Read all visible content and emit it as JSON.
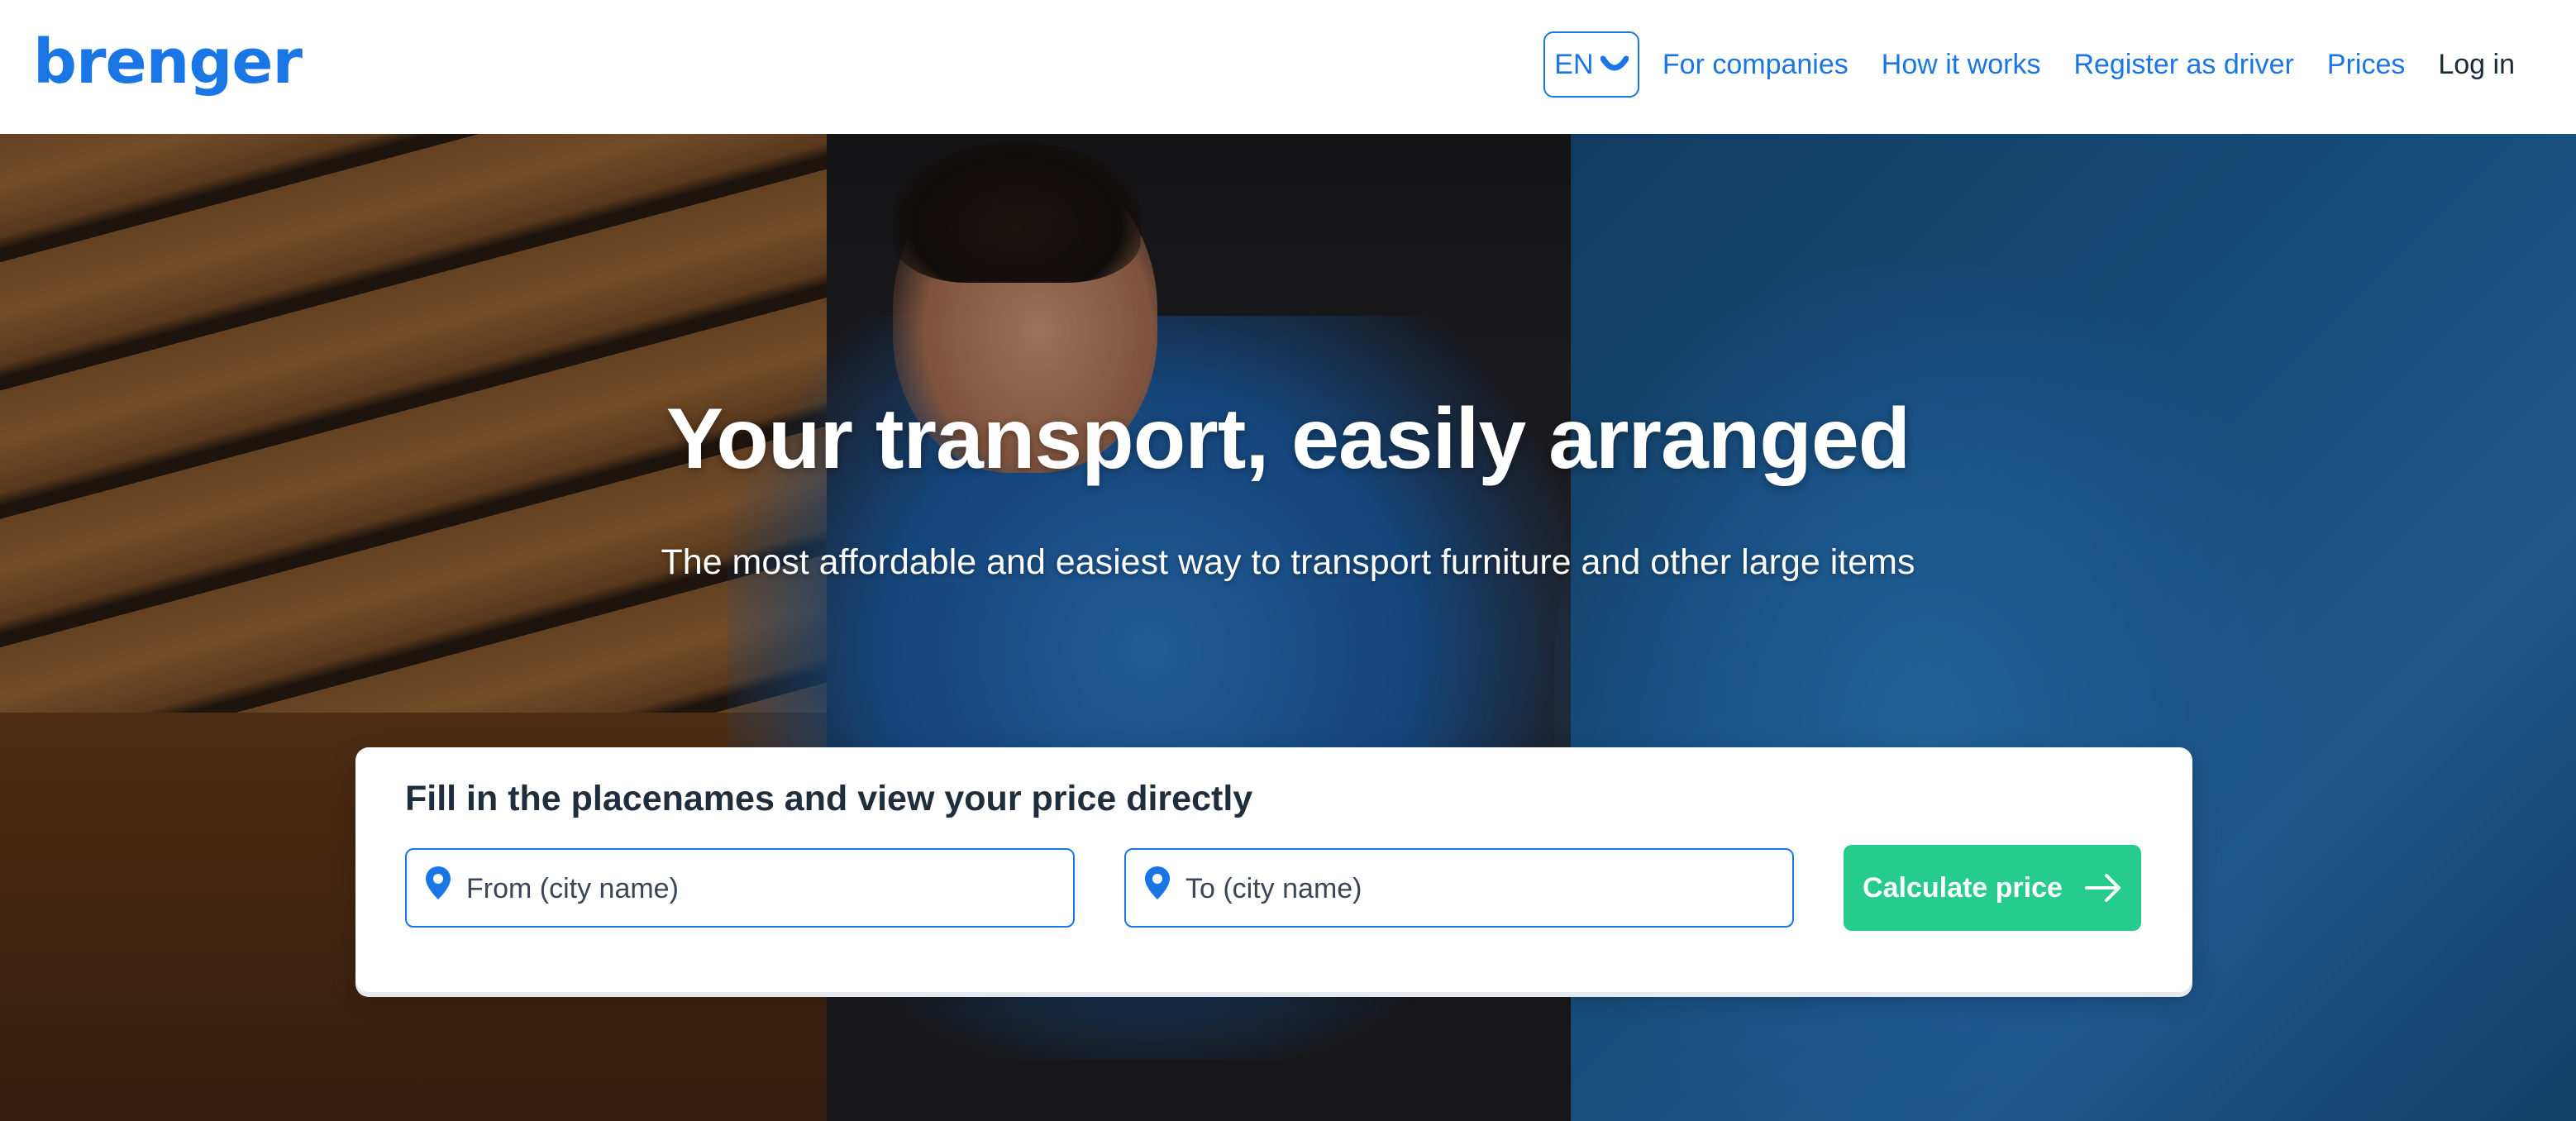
{
  "header": {
    "logo": "brenger",
    "language": "EN",
    "nav": [
      {
        "label": "For companies"
      },
      {
        "label": "How it works"
      },
      {
        "label": "Register as driver"
      },
      {
        "label": "Prices"
      },
      {
        "label": "Log in"
      }
    ]
  },
  "hero": {
    "title": "Your transport, easily arranged",
    "subtitle": "The most affordable and easiest way to transport furniture and other large items"
  },
  "search": {
    "title": "Fill in the placenames and view your price directly",
    "from_placeholder": "From (city name)",
    "to_placeholder": "To (city name)",
    "submit_label": "Calculate price"
  },
  "icons": {
    "language": "chevron-down-icon",
    "field": "map-pin-icon",
    "submit": "arrow-right-icon"
  },
  "colors": {
    "brand_blue": "#1b76e5",
    "accent_green": "#25cc8e",
    "text_dark": "#1f2d3d"
  }
}
